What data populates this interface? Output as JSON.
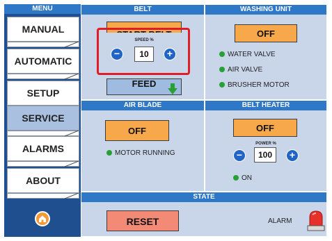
{
  "sidebar": {
    "header": "MENU",
    "items": [
      {
        "label": "MANUAL"
      },
      {
        "label": "AUTOMATIC"
      },
      {
        "label": "SETUP"
      },
      {
        "label": "SERVICE"
      },
      {
        "label": "ALARMS"
      },
      {
        "label": "ABOUT"
      }
    ],
    "active_item": "SERVICE",
    "home_icon": "home-icon"
  },
  "belt": {
    "title": "BELT",
    "start_label": "START BELT",
    "speed_label": "SPEED %",
    "speed_value": "10",
    "minus": "−",
    "plus": "+",
    "feed_label": "FEED",
    "feed_icon": "arrow-down-icon"
  },
  "washing": {
    "title": "WASHING UNIT",
    "off_label": "OFF",
    "status": [
      "WATER VALVE",
      "AIR VALVE",
      "BRUSHER MOTOR"
    ]
  },
  "air_blade": {
    "title": "AIR BLADE",
    "off_label": "OFF",
    "status": "MOTOR RUNNING"
  },
  "belt_heater": {
    "title": "BELT HEATER",
    "off_label": "OFF",
    "power_label": "POWER %",
    "power_value": "100",
    "minus": "−",
    "plus": "+",
    "status": "ON"
  },
  "state": {
    "title": "STATE",
    "reset_label": "RESET",
    "alarm_label": "ALARM",
    "alarm_icon": "alarm-beacon-icon"
  },
  "colors": {
    "accent": "#2f78c8",
    "orange": "#f7a84a",
    "led_green": "#27a035",
    "highlight": "#e01c24",
    "reset": "#f28a76"
  }
}
